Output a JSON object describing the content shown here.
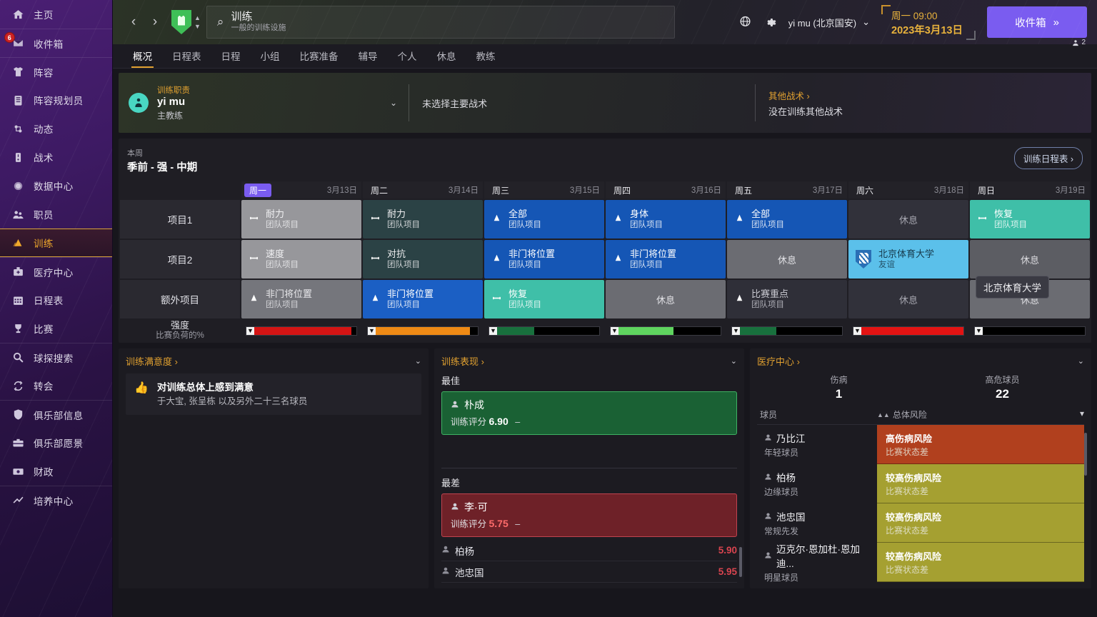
{
  "sidebar": {
    "items": [
      {
        "label": "主页",
        "icon": "home-icon",
        "sep": false,
        "badge": null
      },
      {
        "label": "收件箱",
        "icon": "inbox-icon",
        "sep": true,
        "badge": "6"
      },
      {
        "label": "阵容",
        "icon": "shirt-icon",
        "sep": true,
        "badge": null
      },
      {
        "label": "阵容规划员",
        "icon": "clipboard-icon",
        "sep": false,
        "badge": null
      },
      {
        "label": "动态",
        "icon": "dynamics-icon",
        "sep": false,
        "badge": null
      },
      {
        "label": "战术",
        "icon": "tactics-icon",
        "sep": false,
        "badge": null
      },
      {
        "label": "数据中心",
        "icon": "data-hub-icon",
        "sep": false,
        "badge": null
      },
      {
        "label": "职员",
        "icon": "staff-icon",
        "sep": false,
        "badge": null
      },
      {
        "label": "训练",
        "icon": "training-icon",
        "sep": false,
        "badge": null,
        "active": true
      },
      {
        "label": "医疗中心",
        "icon": "medical-icon",
        "sep": true,
        "badge": null
      },
      {
        "label": "日程表",
        "icon": "calendar-icon",
        "sep": false,
        "badge": null
      },
      {
        "label": "比赛",
        "icon": "trophy-icon",
        "sep": false,
        "badge": null
      },
      {
        "label": "球探搜索",
        "icon": "search-icon",
        "sep": true,
        "badge": null
      },
      {
        "label": "转会",
        "icon": "transfer-icon",
        "sep": false,
        "badge": null
      },
      {
        "label": "俱乐部信息",
        "icon": "shield-icon",
        "sep": true,
        "badge": null
      },
      {
        "label": "俱乐部愿景",
        "icon": "briefcase-icon",
        "sep": false,
        "badge": null
      },
      {
        "label": "财政",
        "icon": "money-icon",
        "sep": false,
        "badge": null
      },
      {
        "label": "培养中心",
        "icon": "development-icon",
        "sep": true,
        "badge": null
      }
    ]
  },
  "topbar": {
    "back_icon": "chevron-left-icon",
    "forward_icon": "chevron-right-icon",
    "search_title": "训练",
    "search_subtitle": "一般的训练设施",
    "search_icon": "magnifier-icon",
    "world_icon": "globe-icon",
    "settings_icon": "gear-icon",
    "manager": "yi mu (北京国安)",
    "date_time": "周一 09:00",
    "date_full": "2023年3月13日",
    "continue_label": "收件箱",
    "continue_chevrons": "»",
    "people_count": "2"
  },
  "tabs": [
    {
      "label": "概况",
      "active": true
    },
    {
      "label": "日程表",
      "active": false
    },
    {
      "label": "日程",
      "active": false
    },
    {
      "label": "小组",
      "active": false
    },
    {
      "label": "比赛准备",
      "active": false
    },
    {
      "label": "辅导",
      "active": false
    },
    {
      "label": "个人",
      "active": false
    },
    {
      "label": "休息",
      "active": false
    },
    {
      "label": "教练",
      "active": false
    }
  ],
  "responsibility": {
    "kicker": "训练职责",
    "name": "yi mu",
    "role": "主教练",
    "primary_tactic": "未选择主要战术",
    "other_link": "其他战术 ›",
    "other_note": "没在训练其他战术"
  },
  "schedule": {
    "kicker": "本周",
    "title": "季前 - 强 - 中期",
    "button": "训练日程表 ›",
    "days": [
      {
        "label": "周一",
        "date": "3月13日",
        "today": true
      },
      {
        "label": "周二",
        "date": "3月14日",
        "today": false
      },
      {
        "label": "周三",
        "date": "3月15日",
        "today": false
      },
      {
        "label": "周四",
        "date": "3月16日",
        "today": false
      },
      {
        "label": "周五",
        "date": "3月17日",
        "today": false
      },
      {
        "label": "周六",
        "date": "3月18日",
        "today": false
      },
      {
        "label": "周日",
        "date": "3月19日",
        "today": false
      }
    ],
    "row_labels": [
      "项目1",
      "项目2",
      "额外项目"
    ],
    "rows": [
      [
        {
          "t1": "耐力",
          "t2": "团队项目",
          "icon": "dumbbell-icon",
          "cls": "c-gray"
        },
        {
          "t1": "耐力",
          "t2": "团队项目",
          "icon": "dumbbell-icon",
          "cls": "c-teal"
        },
        {
          "t1": "全部",
          "t2": "团队项目",
          "icon": "cone-icon",
          "cls": "c-blue"
        },
        {
          "t1": "身体",
          "t2": "团队项目",
          "icon": "cone-icon",
          "cls": "c-blue"
        },
        {
          "t1": "全部",
          "t2": "团队项目",
          "icon": "cone-icon",
          "cls": "c-blue"
        },
        {
          "t1": "休息",
          "t2": "",
          "icon": "",
          "cls": "c-restdk",
          "rest": true
        },
        {
          "t1": "恢复",
          "t2": "团队项目",
          "icon": "dumbbell-icon",
          "cls": "c-mint"
        }
      ],
      [
        {
          "t1": "速度",
          "t2": "团队项目",
          "icon": "dumbbell-icon",
          "cls": "c-gray"
        },
        {
          "t1": "对抗",
          "t2": "团队项目",
          "icon": "dumbbell-icon",
          "cls": "c-teal"
        },
        {
          "t1": "非门将位置",
          "t2": "团队项目",
          "icon": "cone-icon",
          "cls": "c-blue"
        },
        {
          "t1": "非门将位置",
          "t2": "团队项目",
          "icon": "cone-icon",
          "cls": "c-blue"
        },
        {
          "t1": "休息",
          "t2": "",
          "icon": "",
          "cls": "c-restg",
          "rest": true
        },
        {
          "t1": "北京体育大学",
          "t2": "友谊",
          "icon": "uni-crest-icon",
          "cls": "c-cyan"
        },
        {
          "t1": "休息",
          "t2": "",
          "icon": "",
          "cls": "c-restd",
          "rest": true
        }
      ],
      [
        {
          "t1": "非门将位置",
          "t2": "团队项目",
          "icon": "cone-icon",
          "cls": "c-gray2"
        },
        {
          "t1": "非门将位置",
          "t2": "团队项目",
          "icon": "cone-icon",
          "cls": "c-blued"
        },
        {
          "t1": "恢复",
          "t2": "团队项目",
          "icon": "dumbbell-icon",
          "cls": "c-mint"
        },
        {
          "t1": "休息",
          "t2": "",
          "icon": "",
          "cls": "c-restg",
          "rest": true
        },
        {
          "t1": "比赛重点",
          "t2": "团队项目",
          "icon": "cone-icon",
          "cls": "c-dark"
        },
        {
          "t1": "休息",
          "t2": "",
          "icon": "",
          "cls": "c-restdk",
          "rest": true
        },
        {
          "t1": "休息",
          "t2": "",
          "icon": "",
          "cls": "c-restg",
          "rest": true
        }
      ]
    ],
    "intensity_label": "强度",
    "intensity_sub": "比赛负荷的%",
    "intensity": [
      {
        "pct": 88,
        "color": "#d41414"
      },
      {
        "pct": 86,
        "color": "#ef8a15"
      },
      {
        "pct": 34,
        "color": "#18703d"
      },
      {
        "pct": 50,
        "color": "#5fd45f"
      },
      {
        "pct": 33,
        "color": "#18703d"
      },
      {
        "pct": 97,
        "color": "#e31313"
      },
      {
        "pct": 0,
        "color": "#000000"
      }
    ]
  },
  "satisfaction": {
    "title": "训练满意度 ›",
    "chevron": "chevron-down-icon",
    "headline": "对训练总体上感到满意",
    "detail": "于大宝, 张呈栋 以及另外二十三名球员"
  },
  "performance": {
    "title": "训练表现 ›",
    "chevron": "chevron-down-icon",
    "best_label": "最佳",
    "best": {
      "name": "朴成",
      "rating_label": "训练评分",
      "rating": "6.90",
      "trend": "–"
    },
    "worst_label": "最差",
    "worst": {
      "name": "李·可",
      "rating_label": "训练评分",
      "rating": "5.75",
      "trend": "–"
    },
    "list": [
      {
        "name": "柏杨",
        "value": "5.90"
      },
      {
        "name": "池忠国",
        "value": "5.95"
      }
    ]
  },
  "medical": {
    "title": "医疗中心 ›",
    "chevron": "chevron-down-icon",
    "stats": [
      {
        "label": "伤病",
        "value": "1"
      },
      {
        "label": "高危球员",
        "value": "22"
      }
    ],
    "col_player": "球员",
    "col_risk": "总体风险",
    "sort_icon": "sort-asc-icon",
    "filter_icon": "chevron-down-icon",
    "rows": [
      {
        "name": "乃比江",
        "role": "年轻球员",
        "risk": "高伤病风险",
        "note": "比赛状态差",
        "level": "risk-hi"
      },
      {
        "name": "柏杨",
        "role": "边缘球员",
        "risk": "较高伤病风险",
        "note": "比赛状态差",
        "level": "risk-md"
      },
      {
        "name": "池忠国",
        "role": "常规先发",
        "risk": "较高伤病风险",
        "note": "比赛状态差",
        "level": "risk-md"
      },
      {
        "name": "迈克尔·恩加杜·恩加迪...",
        "role": "明星球员",
        "risk": "较高伤病风险",
        "note": "比赛状态差",
        "level": "risk-md"
      }
    ]
  },
  "tooltip": {
    "text": "北京体育大学"
  }
}
